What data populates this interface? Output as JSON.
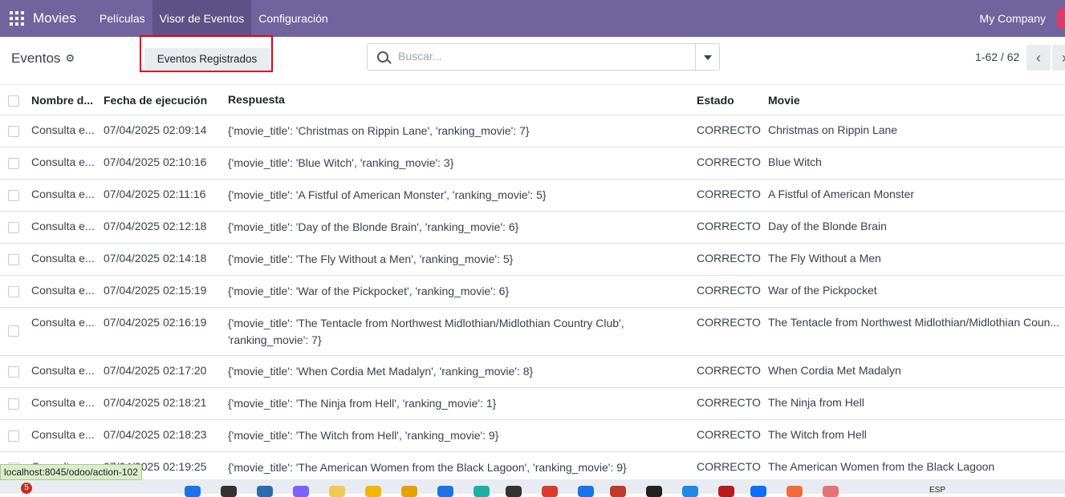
{
  "navbar": {
    "brand": "Movies",
    "menu": [
      {
        "label": "Películas"
      },
      {
        "label": "Visor de Eventos"
      },
      {
        "label": "Configuración"
      }
    ],
    "company": "My Company"
  },
  "control": {
    "breadcrumb": "Eventos",
    "button_label": "Eventos Registrados",
    "search_placeholder": "Buscar...",
    "pager": "1-62 / 62"
  },
  "table": {
    "columns": [
      "Nombre d...",
      "Fecha de ejecución",
      "Respuesta",
      "Estado",
      "Movie"
    ],
    "rows": [
      {
        "name": "Consulta e...",
        "date": "07/04/2025 02:09:14",
        "response": "{'movie_title': 'Christmas on Rippin Lane', 'ranking_movie': 7}",
        "state": "CORRECTO",
        "movie": "Christmas on Rippin Lane"
      },
      {
        "name": "Consulta e...",
        "date": "07/04/2025 02:10:16",
        "response": "{'movie_title': 'Blue Witch', 'ranking_movie': 3}",
        "state": "CORRECTO",
        "movie": "Blue Witch"
      },
      {
        "name": "Consulta e...",
        "date": "07/04/2025 02:11:16",
        "response": "{'movie_title': 'A Fistful of American Monster', 'ranking_movie': 5}",
        "state": "CORRECTO",
        "movie": "A Fistful of American Monster"
      },
      {
        "name": "Consulta e...",
        "date": "07/04/2025 02:12:18",
        "response": "{'movie_title': 'Day of the Blonde Brain', 'ranking_movie': 6}",
        "state": "CORRECTO",
        "movie": "Day of the Blonde Brain"
      },
      {
        "name": "Consulta e...",
        "date": "07/04/2025 02:14:18",
        "response": "{'movie_title': 'The Fly Without a Men', 'ranking_movie': 5}",
        "state": "CORRECTO",
        "movie": "The Fly Without a Men"
      },
      {
        "name": "Consulta e...",
        "date": "07/04/2025 02:15:19",
        "response": "{'movie_title': 'War of the Pickpocket', 'ranking_movie': 6}",
        "state": "CORRECTO",
        "movie": "War of the Pickpocket"
      },
      {
        "name": "Consulta e...",
        "date": "07/04/2025 02:16:19",
        "response": "{'movie_title': 'The Tentacle from Northwest Midlothian/Midlothian Country Club', 'ranking_movie': 7}",
        "state": "CORRECTO",
        "movie": "The Tentacle from Northwest Midlothian/Midlothian Coun..."
      },
      {
        "name": "Consulta e...",
        "date": "07/04/2025 02:17:20",
        "response": "{'movie_title': 'When Cordia Met Madalyn', 'ranking_movie': 8}",
        "state": "CORRECTO",
        "movie": "When Cordia Met Madalyn"
      },
      {
        "name": "Consulta e...",
        "date": "07/04/2025 02:18:21",
        "response": "{'movie_title': 'The Ninja from Hell', 'ranking_movie': 1}",
        "state": "CORRECTO",
        "movie": "The Ninja from Hell"
      },
      {
        "name": "Consulta e...",
        "date": "07/04/2025 02:18:23",
        "response": "{'movie_title': 'The Witch from Hell', 'ranking_movie': 9}",
        "state": "CORRECTO",
        "movie": "The Witch from Hell"
      },
      {
        "name": "Consulta e...",
        "date": "07/04/2025 02:19:25",
        "response": "{'movie_title': 'The American Women from the Black Lagoon', 'ranking_movie': 9}",
        "state": "CORRECTO",
        "movie": "The American Women from the Black Lagoon"
      }
    ]
  },
  "statusbar": {
    "url": "localhost:8045/odoo/action-102"
  },
  "taskbar": {
    "badge": "5",
    "lang": "ESP"
  }
}
